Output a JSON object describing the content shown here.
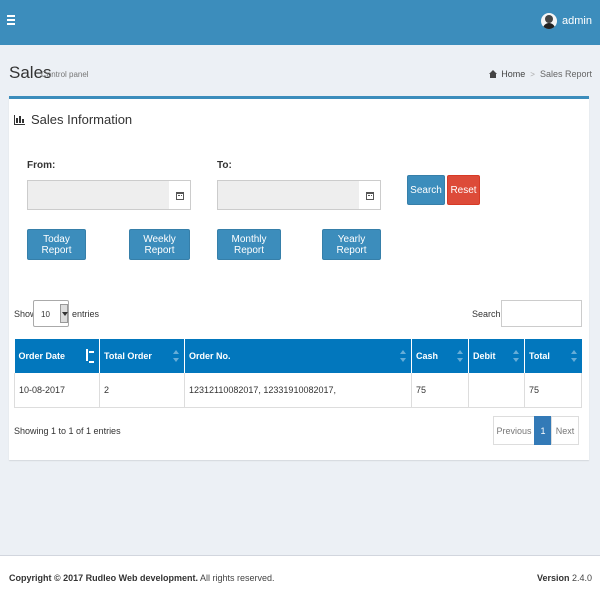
{
  "topbar": {
    "user_name": "admin"
  },
  "header": {
    "title": "Sales",
    "subtitle": "Control panel",
    "breadcrumb": {
      "home": "Home",
      "current": "Sales Report"
    }
  },
  "box": {
    "title": "Sales Information"
  },
  "filters": {
    "from_label": "From:",
    "to_label": "To:",
    "from_value": "",
    "to_value": "",
    "search_label": "Search",
    "reset_label": "Reset",
    "today_label": "Today Report",
    "weekly_label": "Weekly Report",
    "monthly_label": "Monthly Report",
    "yearly_label": "Yearly Report"
  },
  "table_controls": {
    "show_label": "Show",
    "page_length": "10",
    "entries_label": "entries",
    "search_label": "Search:",
    "search_value": ""
  },
  "table": {
    "columns": [
      "Order Date",
      "Total Order",
      "Order No.",
      "Cash",
      "Debit",
      "Total"
    ],
    "rows": [
      [
        "10-08-2017",
        "2",
        "12312110082017, 12331910082017,",
        "75",
        "",
        "75"
      ]
    ]
  },
  "pagination": {
    "info": "Showing 1 to 1 of 1 entries",
    "previous": "Previous",
    "current": "1",
    "next": "Next"
  },
  "footer": {
    "copyright": "Copyright © 2017 Rudleo Web development.",
    "rights": "All rights reserved.",
    "version_label": "Version",
    "version_value": "2.4.0"
  },
  "colors": {
    "primary": "#3c8dbc",
    "danger": "#dd4b39",
    "table_header": "#0277bd",
    "page_active": "#337ab7"
  }
}
